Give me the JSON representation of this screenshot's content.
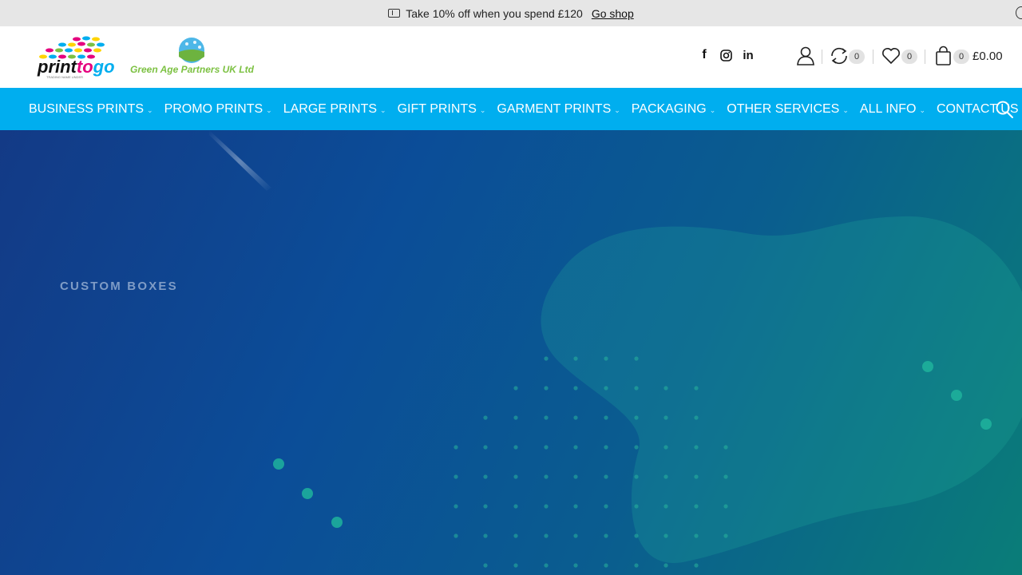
{
  "promo": {
    "text": "Take 10% off when you spend £120",
    "link": "Go shop"
  },
  "header": {
    "logo_text": "printogo",
    "logo_tagline": "TRADING NAME UNDER",
    "partner_name": "Green Age Partners UK Ltd",
    "compare_count": "0",
    "wishlist_count": "0",
    "cart_count": "0",
    "cart_total": "£0.00"
  },
  "nav": {
    "items": [
      {
        "label": "BUSINESS PRINTS",
        "has_dropdown": true
      },
      {
        "label": "PROMO PRINTS",
        "has_dropdown": true
      },
      {
        "label": "LARGE PRINTS",
        "has_dropdown": true
      },
      {
        "label": "GIFT PRINTS",
        "has_dropdown": true
      },
      {
        "label": "GARMENT PRINTS",
        "has_dropdown": true
      },
      {
        "label": "PACKAGING",
        "has_dropdown": true
      },
      {
        "label": "OTHER SERVICES",
        "has_dropdown": true
      },
      {
        "label": "ALL INFO",
        "has_dropdown": true
      },
      {
        "label": "CONTACT US",
        "has_dropdown": false
      }
    ]
  },
  "hero": {
    "eyebrow": "CUSTOM BOXES"
  },
  "colors": {
    "nav_bg": "#00aeef",
    "partner_green": "#7cc142",
    "hero_blue": "#133a86",
    "hero_teal": "#0a7d78",
    "dot_teal": "#2ab59c"
  }
}
